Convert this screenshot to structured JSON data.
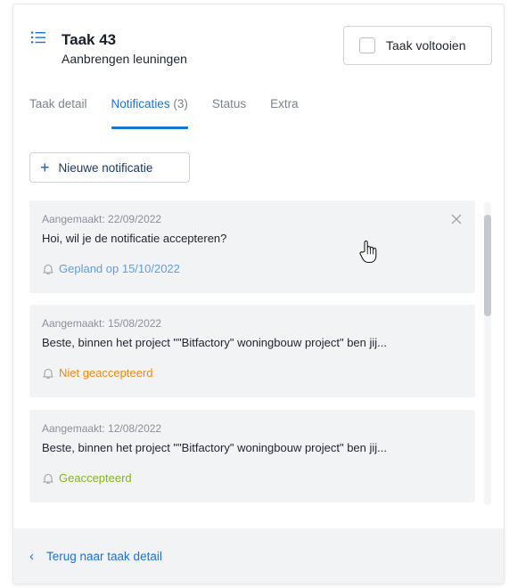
{
  "header": {
    "title": "Taak 43",
    "subtitle": "Aanbrengen leuningen",
    "icon": "list-icon",
    "complete_label": "Taak voltooien"
  },
  "tabs": [
    {
      "label": "Taak detail",
      "count": ""
    },
    {
      "label": "Notificaties",
      "count": "(3)",
      "active": true
    },
    {
      "label": "Status",
      "count": ""
    },
    {
      "label": "Extra",
      "count": ""
    }
  ],
  "new_notification_label": "Nieuwe notificatie",
  "notifications": [
    {
      "created": "Aangemaakt: 22/09/2022",
      "message": "Hoi, wil je de notificatie accepteren?",
      "status": "Gepland op 15/10/2022",
      "status_color": "#5b9ee6"
    },
    {
      "created": "Aangemaakt: 15/08/2022",
      "message": "Beste, binnen het project \"\"Bitfactory\" woningbouw project\" ben jij...",
      "status": "Niet geaccepteerd",
      "status_color": "#f08a0c"
    },
    {
      "created": "Aangemaakt: 12/08/2022",
      "message": "Beste, binnen het project \"\"Bitfactory\" woningbouw project\" ben jij...",
      "status": "Geaccepteerd",
      "status_color": "#86b51e"
    }
  ],
  "footer": {
    "back_label": "Terug naar taak detail"
  },
  "colors": {
    "accent": "#1b73d9",
    "card_bg": "#f2f3f5"
  }
}
